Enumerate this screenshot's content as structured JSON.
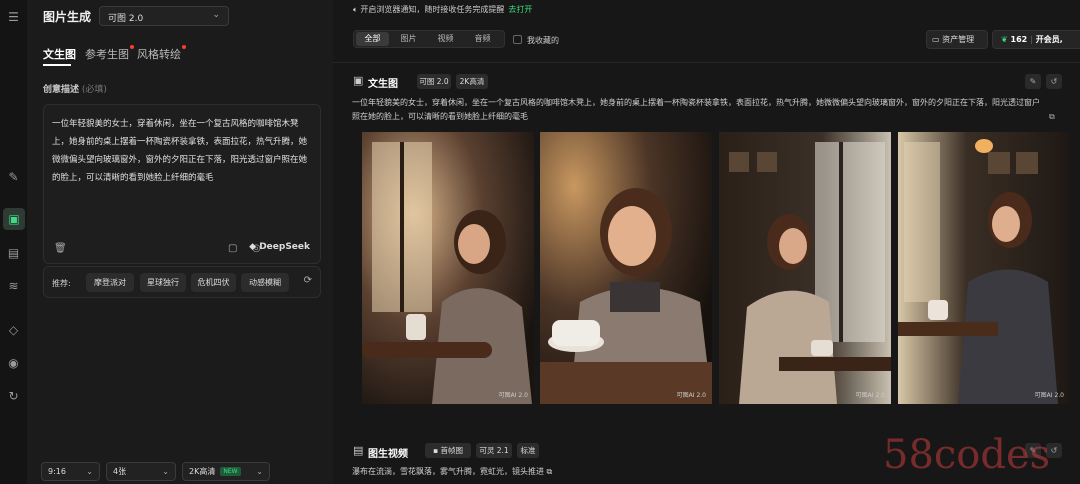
{
  "rail": {
    "icons": [
      "menu-icon",
      "ai-edit-icon",
      "image-icon",
      "calendar-icon",
      "waveform-icon",
      "cube-icon",
      "eye-icon",
      "history-icon"
    ]
  },
  "sidebar": {
    "title": "图片生成",
    "model": "可图 2.0",
    "tabs": [
      {
        "label": "文生图"
      },
      {
        "label": "参考生图"
      },
      {
        "label": "风格转绘"
      }
    ],
    "description_label": "创意描述",
    "description_required": "(必填)",
    "description_text": "一位年轻貌美的女士，穿着休闲，坐在一个复古风格的咖啡馆木凳上，她身前的桌上摆着一杯陶瓷杯装拿铁，表面拉花，热气升腾，她微微偏头望向玻璃窗外，窗外的夕阳正在下落，阳光透过窗户照在她的脸上，可以清晰的看到她脸上纤细的毫毛",
    "deepseek_label": "DeepSeek",
    "recommend_label": "推荐:",
    "recommend_chips": [
      "摩登派对",
      "星球独行",
      "危机四伏",
      "动感模糊"
    ],
    "ratio": "9:16",
    "count": "4张",
    "quality": "2K高清",
    "new_badge": "NEW"
  },
  "topbar": {
    "notice": "开启浏览器通知，随时接收任务完成提醒",
    "notice_link": "去打开",
    "filters": [
      "全部",
      "图片",
      "视频",
      "音频"
    ],
    "favorites_label": "我收藏的",
    "asset_button": "资产管理",
    "credits": "162",
    "member": "开会员,"
  },
  "result1": {
    "title": "文生图",
    "tags": [
      "可图 2.0",
      "2K高清"
    ],
    "prompt": "一位年轻貌美的女士，穿着休闲，坐在一个复古风格的咖啡馆木凳上，她身前的桌上摆着一杯陶瓷杯装拿铁，表面拉花，热气升腾，她微微偏头望向玻璃窗外，窗外的夕阳正在下落，阳光透过窗户照在她的脸上，可以清晰的看到她脸上纤细的毫毛",
    "watermark": "可图AI 2.0"
  },
  "result2": {
    "title": "图生视频",
    "tags": [
      "首帧图",
      "可灵 2.1",
      "标准"
    ],
    "prompt": "瀑布在流淌，雪花飘落，雾气升腾，霓虹光，镜头推进"
  },
  "site_watermark": "58codes"
}
